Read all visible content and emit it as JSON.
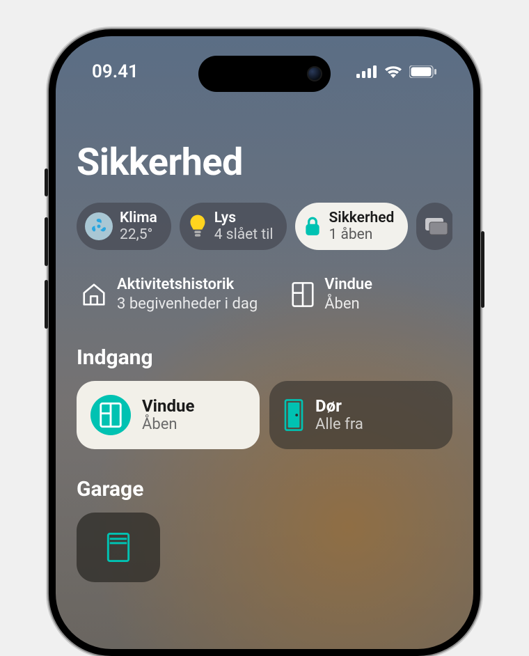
{
  "status": {
    "time": "09.41"
  },
  "page": {
    "title": "Sikkerhed"
  },
  "pills": {
    "climate": {
      "label": "Klima",
      "value": "22,5°"
    },
    "lights": {
      "label": "Lys",
      "value": "4 slået til"
    },
    "security": {
      "label": "Sikkerhed",
      "value": "1 åben"
    }
  },
  "info": {
    "activity": {
      "label": "Aktivitetshistorik",
      "value": "3 begivenheder i dag"
    },
    "window": {
      "label": "Vindue",
      "value": "Åben"
    }
  },
  "sections": {
    "entry": {
      "title": "Indgang"
    },
    "garage": {
      "title": "Garage"
    }
  },
  "tiles": {
    "window": {
      "label": "Vindue",
      "value": "Åben"
    },
    "door": {
      "label": "Dør",
      "value": "Alle fra"
    }
  }
}
